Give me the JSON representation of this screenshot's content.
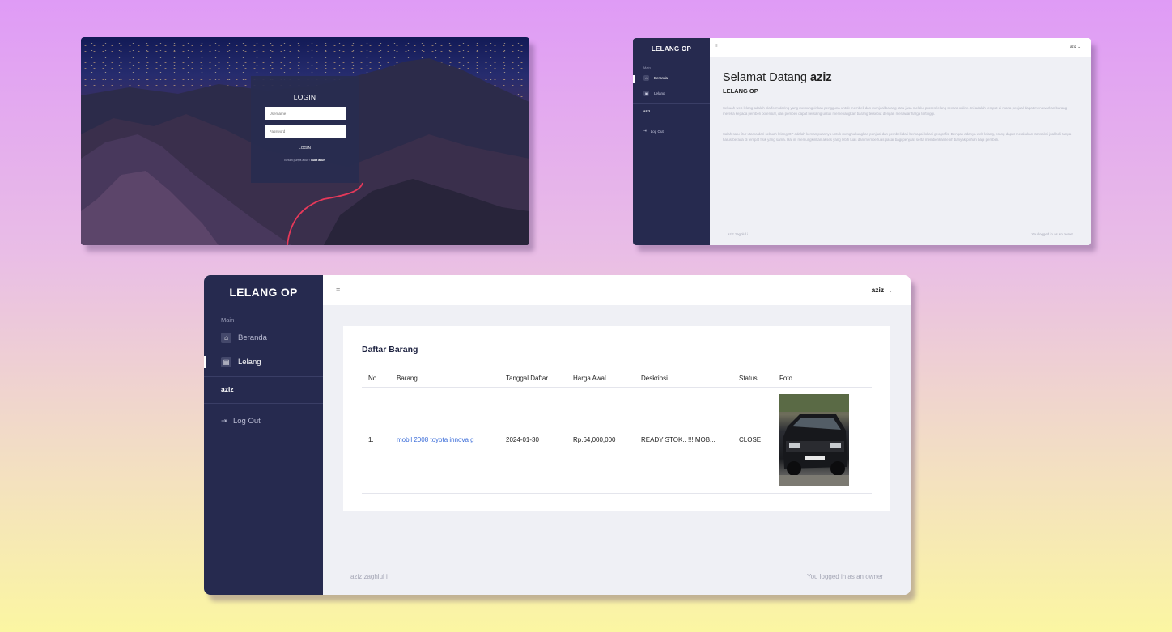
{
  "login": {
    "title": "LOGIN",
    "username_placeholder": "Username",
    "password_placeholder": "Password",
    "button_label": "LOGIN",
    "register_prompt": "Belum punya akun?",
    "register_link": "Buat akun"
  },
  "welcome_app": {
    "brand": "LELANG OP",
    "section_label": "Main",
    "nav": [
      {
        "label": "Beranda",
        "icon": "home-icon"
      },
      {
        "label": "Lelang",
        "icon": "auction-icon"
      }
    ],
    "username": "aziz",
    "logout_label": "Log Out",
    "menu_icon": "≡",
    "topbar_user": "aziz",
    "greeting": "Selamat Datang",
    "greeting_name": "aziz",
    "subtitle": "LELANG OP",
    "paragraph1": "Sebuah web lelang adalah platform daring yang memungkinkan pengguna untuk membeli dan menjual barang atau jasa melalui proses lelang secara online. Ini adalah tempat di mana penjual dapat menawarkan barang mereka kepada pembeli potensial, dan pembeli dapat bersaing untuk memenangkan barang tersebut dengan menawar harga tertinggi.",
    "paragraph2": "Salah satu fitur utama dari sebuah lelang OP adalah kemampuannya untuk menghubungkan penjual dan pembeli dari berbagai lokasi geografis. Dengan adanya web lelang, orang dapat melakukan transaksi jual beli tanpa harus berada di tempat fisik yang sama. Hal ini memungkinkan akses yang lebih luas dan memperluas pasar bagi penjual, serta memberikan lebih banyak pilihan bagi pembeli.",
    "footer_left": "aziz zaghlul i",
    "footer_right": "You logged in as an owner"
  },
  "main_app": {
    "brand": "LELANG OP",
    "section_label": "Main",
    "nav": [
      {
        "label": "Beranda",
        "icon": "home-icon",
        "active": false
      },
      {
        "label": "Lelang",
        "icon": "auction-icon",
        "active": true
      }
    ],
    "username": "aziz",
    "logout_label": "Log Out",
    "menu_icon": "≡",
    "topbar_user": "aziz",
    "card_title": "Daftar Barang",
    "table": {
      "headers": [
        "No.",
        "Barang",
        "Tanggal Daftar",
        "Harga Awal",
        "Deskripsi",
        "Status",
        "Foto"
      ],
      "rows": [
        {
          "no": "1.",
          "barang": "mobil 2008 toyota innova g",
          "tanggal": "2024-01-30",
          "harga": "Rp.64,000,000",
          "deskripsi": "READY STOK.. !!! MOB...",
          "status": "CLOSE",
          "foto": "car-photo"
        }
      ]
    },
    "footer_left": "aziz zaghlul i",
    "footer_right": "You logged in as an owner"
  },
  "colors": {
    "sidebar": "#262a4f",
    "content_bg": "#eff0f5",
    "link": "#3a6cd9"
  }
}
